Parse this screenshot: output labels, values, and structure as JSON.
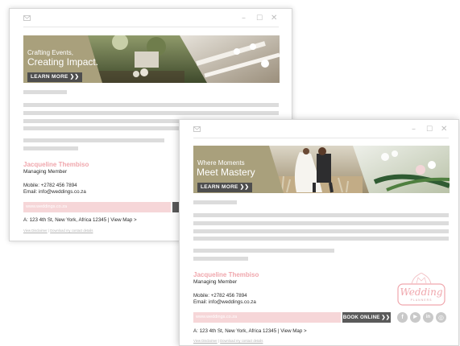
{
  "window1": {
    "banner": {
      "line1": "Crafting Events,",
      "line2": "Creating Impact.",
      "button": "LEARN MORE ❯❯"
    },
    "signature": {
      "name": "Jacqueline Thembiso",
      "title": "Managing Member",
      "mobile": "Mobile: +2782 456 7894",
      "email": "Email: info@weddings.co.za",
      "website": "www.weddings.co.za",
      "address": "A: 123 4th St, New York, Africa 12345  |  View Map >",
      "disclaimer": "View Disclaimer",
      "separator": "|",
      "download": "Download my contact details"
    }
  },
  "window2": {
    "banner": {
      "line1": "Where Moments",
      "line2": "Meet Mastery",
      "button": "LEARN MORE ❯❯"
    },
    "signature": {
      "name": "Jacqueline Thembiso",
      "title": "Managing Member",
      "mobile": "Mobile: +2782 456 7894",
      "email": "Email: info@weddings.co.za",
      "website": "www.weddings.co.za",
      "book_button": "BOOK ONLINE ❯❯",
      "address": "A: 123 4th St, New York, Africa 12345  |  View Map >",
      "disclaimer": "View Disclaimer",
      "separator": "|",
      "download": "Download my contact details",
      "logo_text": "Wedding",
      "logo_subtext": "PLANNERS",
      "social": {
        "facebook": "f",
        "youtube": "▶",
        "linkedin": "in",
        "instagram": "◎"
      }
    }
  },
  "window_controls": {
    "minimize": "–",
    "maximize": "☐",
    "close": "✕"
  },
  "colors": {
    "accent_pink": "#f0a7ad",
    "web_bar": "#f6d6d8",
    "banner_olive": "#a9a07c",
    "button_grey": "#4e4e4e",
    "placeholder": "#dcdcdc"
  }
}
